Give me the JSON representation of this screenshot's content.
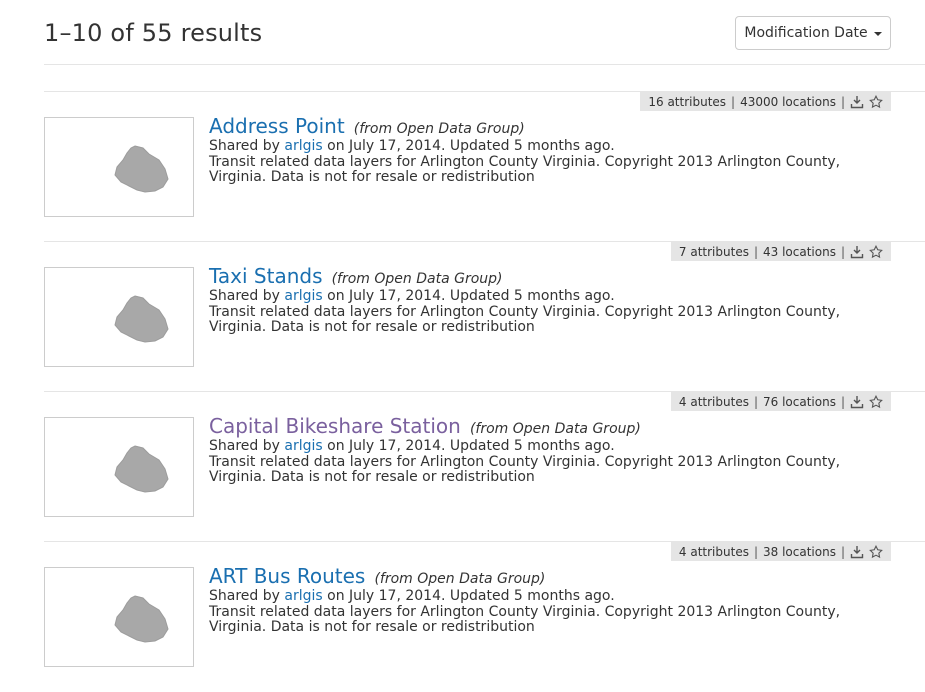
{
  "header": {
    "results_text": "1–10 of 55 results",
    "sort_label": "Modification Date"
  },
  "results": [
    {
      "title": "Address Point",
      "source": "(from Open Data Group)",
      "shared_prefix": "Shared by",
      "user": "arlgis",
      "shared_suffix": "on July 17, 2014. Updated 5 months ago.",
      "description": "Transit related data layers for Arlington County Virginia. Copyright 2013 Arlington County, Virginia. Data is not for resale or redistribution",
      "attributes": "16 attributes",
      "locations": "43000 locations"
    },
    {
      "title": "Taxi Stands",
      "source": "(from Open Data Group)",
      "shared_prefix": "Shared by",
      "user": "arlgis",
      "shared_suffix": "on July 17, 2014. Updated 5 months ago.",
      "description": "Transit related data layers for Arlington County Virginia. Copyright 2013 Arlington County, Virginia. Data is not for resale or redistribution",
      "attributes": "7 attributes",
      "locations": "43 locations"
    },
    {
      "title": "Capital Bikeshare Station",
      "source": "(from Open Data Group)",
      "shared_prefix": "Shared by",
      "user": "arlgis",
      "shared_suffix": "on July 17, 2014. Updated 5 months ago.",
      "description": "Transit related data layers for Arlington County Virginia. Copyright 2013 Arlington County, Virginia. Data is not for resale or redistribution",
      "attributes": "4 attributes",
      "locations": "76 locations"
    },
    {
      "title": "ART Bus Routes",
      "source": "(from Open Data Group)",
      "shared_prefix": "Shared by",
      "user": "arlgis",
      "shared_suffix": "on July 17, 2014. Updated 5 months ago.",
      "description": "Transit related data layers for Arlington County Virginia. Copyright 2013 Arlington County, Virginia. Data is not for resale or redistribution",
      "attributes": "4 attributes",
      "locations": "38 locations"
    }
  ],
  "meta_separator": "|",
  "icons": {
    "download": "download-icon",
    "star": "star-icon",
    "caret": "caret-down-icon",
    "map": "county-map-thumbnail"
  },
  "colors": {
    "link": "#1a6fb0",
    "visited_link": "#7a609e",
    "meta_bg": "#e5e5e5",
    "map_fill": "#a8a8a8"
  }
}
